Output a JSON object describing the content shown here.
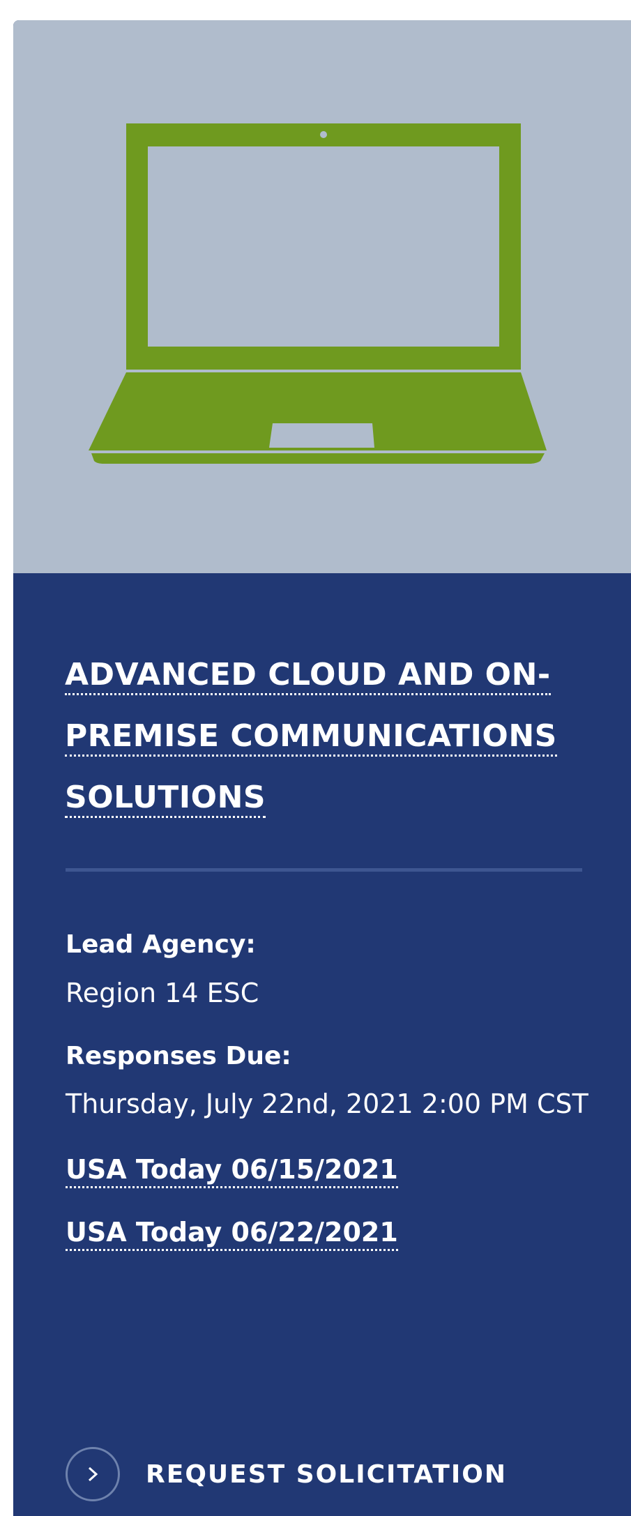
{
  "card": {
    "image": {
      "icon": "laptop-icon",
      "background_color": "#b0bccc",
      "icon_color": "#6f9a1f"
    },
    "title": "ADVANCED CLOUD AND ON-PREMISE COMMUNICATIONS SOLUTIONS",
    "details": {
      "lead_agency_label": "Lead Agency:",
      "lead_agency_value": "Region 14 ESC",
      "responses_due_label": "Responses Due:",
      "responses_due_value": "Thursday, July 22nd, 2021 2:00 PM CST"
    },
    "notices": [
      "USA Today 06/15/2021",
      "USA Today 06/22/2021"
    ],
    "cta": {
      "icon": "chevron-right-icon",
      "label": "REQUEST SOLICITATION"
    },
    "colors": {
      "panel_background": "#213874",
      "divider": "#3e5691",
      "text": "#ffffff"
    }
  }
}
